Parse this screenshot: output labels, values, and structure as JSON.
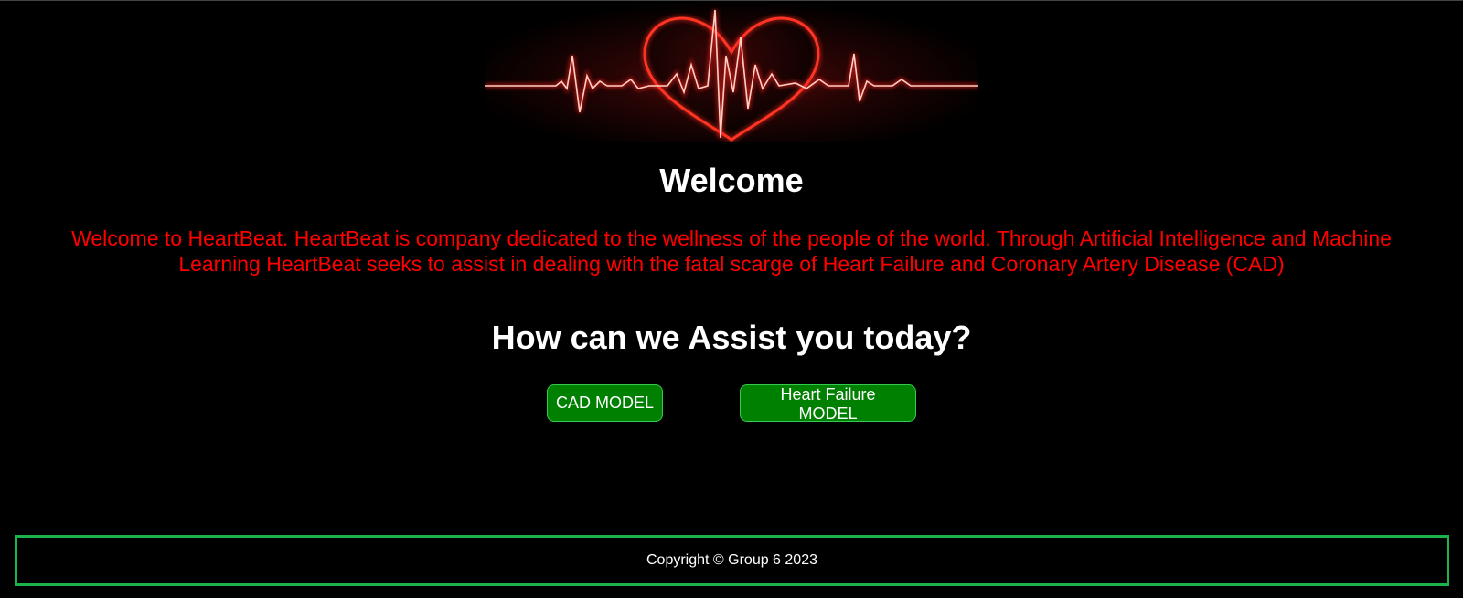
{
  "hero": {
    "image_name": "heartbeat-ecg-heart-banner",
    "accent_color": "#ff2020"
  },
  "welcome": {
    "title": "Welcome",
    "text": "Welcome to HeartBeat. HeartBeat is company dedicated to the wellness of the people of the world. Through Artificial Intelligence and Machine Learning HeartBeat seeks to assist in dealing with the fatal scarge of Heart Failure and Coronary Artery Disease (CAD)",
    "text_color": "#ff0000"
  },
  "assist": {
    "title": "How can we Assist you today?"
  },
  "buttons": {
    "cad_label": "CAD MODEL",
    "heart_failure_label": "Heart Failure MODEL",
    "color": "#008000"
  },
  "footer": {
    "text": "Copyright © Group 6 2023",
    "border_color": "#19b34a"
  }
}
